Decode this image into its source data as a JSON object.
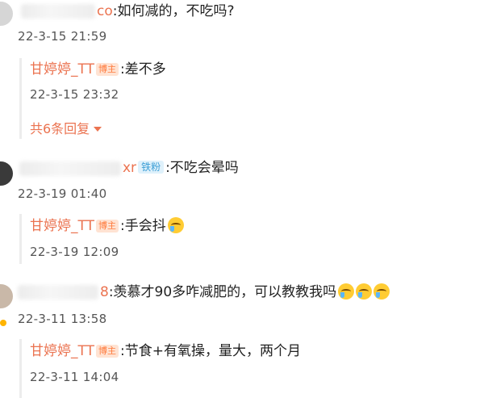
{
  "comments": [
    {
      "name_suffix": "co",
      "text": ":如何减的，不吃吗?",
      "time": "22-3-15 21:59",
      "reply": {
        "name": "甘婷婷_TT",
        "badge": "博主",
        "text": ":差不多",
        "time": "22-3-15 23:32"
      },
      "more_replies": "共6条回复"
    },
    {
      "name_suffix": "xr",
      "fan_badge": "铁粉",
      "text": ":不吃会晕吗",
      "time": "22-3-19 01:40",
      "reply": {
        "name": "甘婷婷_TT",
        "badge": "博主",
        "text": ":手会抖",
        "time": "22-3-19 12:09",
        "emoji": "crying-laughing-emoji"
      }
    },
    {
      "name_suffix": "8",
      "text": ":羡慕才90多咋减肥的，可以教教我吗",
      "emojis": [
        "crying-emoji",
        "crying-emoji",
        "crying-emoji"
      ],
      "time": "22-3-11 13:58",
      "reply": {
        "name": "甘婷婷_TT",
        "badge": "博主",
        "text": ":节食+有氧操，量大，两个月",
        "time": "22-3-11 14:04"
      }
    }
  ],
  "colors": {
    "username": "#eb7350",
    "owner_badge": "#ff7a3c",
    "fan_badge": "#3c9ed6"
  }
}
